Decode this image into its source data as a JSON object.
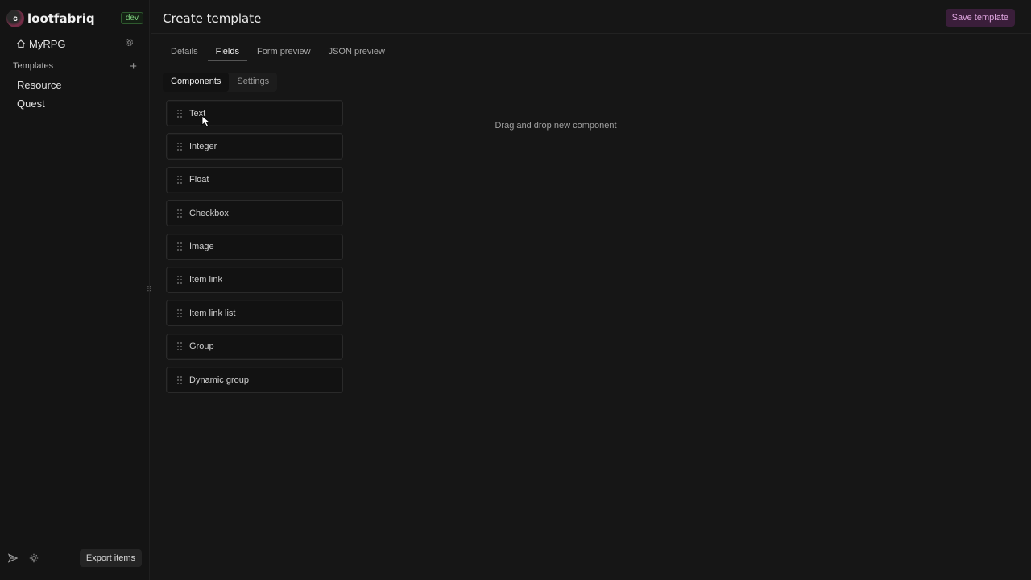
{
  "app": {
    "brand": "lootfabriq",
    "env_badge": "dev",
    "project": "MyRPG"
  },
  "sidebar": {
    "section_title": "Templates",
    "templates": [
      "Resource",
      "Quest"
    ],
    "export_label": "Export items"
  },
  "header": {
    "title": "Create template",
    "save_label": "Save template"
  },
  "tabs": [
    {
      "label": "Details",
      "active": false
    },
    {
      "label": "Fields",
      "active": true
    },
    {
      "label": "Form preview",
      "active": false
    },
    {
      "label": "JSON preview",
      "active": false
    }
  ],
  "subtabs": [
    {
      "label": "Components",
      "active": true
    },
    {
      "label": "Settings",
      "active": false
    }
  ],
  "components": [
    "Text",
    "Integer",
    "Float",
    "Checkbox",
    "Image",
    "Item link",
    "Item link list",
    "Group",
    "Dynamic group"
  ],
  "dropzone_text": "Drag and drop new component",
  "colors": {
    "accent": "#e1a6e1",
    "env_badge": "#7fd07f",
    "background": "#161616"
  }
}
